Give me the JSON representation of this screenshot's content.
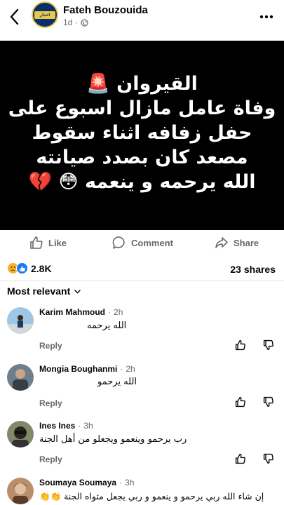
{
  "header": {
    "author": "Fateh Bouzouida",
    "time": "1d",
    "separator": "·",
    "avatar_text": "اخبار الساحل"
  },
  "post": {
    "lines": [
      "القيروان 🚨",
      "وفاة عامل مازال اسبوع على",
      "حفل زفافه اثناء سقوط",
      "مصعد كان بصدد صيانته",
      "الله يرحمه و ينعمه 😳 💔"
    ]
  },
  "actions": {
    "like": "Like",
    "comment": "Comment",
    "share": "Share"
  },
  "stats": {
    "reactions_count": "2.8K",
    "shares": "23 shares"
  },
  "sort": {
    "label": "Most relevant"
  },
  "comments": [
    {
      "name": "Karim Mahmoud",
      "time": "2h",
      "text": "الله يرحمه",
      "reply": "Reply"
    },
    {
      "name": "Mongia Boughanmi",
      "time": "2h",
      "text": "الله يرحمو",
      "reply": "Reply"
    },
    {
      "name": "Ines Ines",
      "time": "3h",
      "text": "رب يرحمو وينعمو  ويجعلو من أهل الجنة",
      "reply": "Reply"
    },
    {
      "name": "Soumaya Soumaya",
      "time": "3h",
      "text": "إن شاء الله ربي يرحمو و ينعمو و ربي يجعل مثواه الجنة 👏👏"
    }
  ],
  "colors": {
    "reaction_sad": "#f7b125",
    "reaction_like": "#1877f2",
    "meta_gray": "#65676b"
  }
}
